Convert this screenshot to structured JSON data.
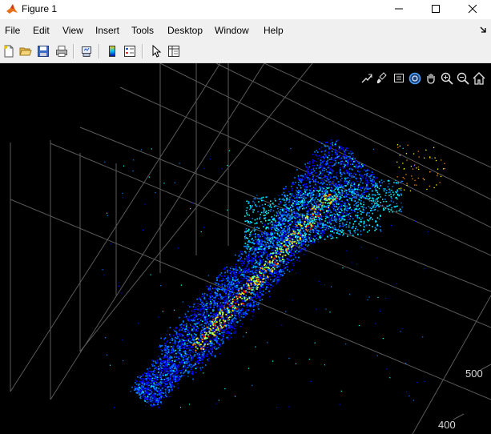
{
  "window": {
    "title": "Figure 1"
  },
  "menu": {
    "items": [
      "File",
      "Edit",
      "View",
      "Insert",
      "Tools",
      "Desktop",
      "Window",
      "Help"
    ]
  },
  "plot": {
    "ticks": [
      "500",
      "400"
    ],
    "colormap": [
      "#00007f",
      "#0000ff",
      "#0080ff",
      "#00ffff",
      "#80ff80",
      "#ffff00",
      "#ff8000",
      "#ff0000"
    ]
  },
  "icons": {
    "toolbar": [
      "new-figure-icon",
      "open-file-icon",
      "save-icon",
      "print-icon",
      "link-plot-icon",
      "colorbar-icon",
      "legend-icon",
      "pointer-icon",
      "property-inspector-icon"
    ],
    "axes": [
      "export-icon",
      "brush-icon",
      "data-tips-icon",
      "rotate-3d-icon",
      "pan-icon",
      "zoom-in-icon",
      "zoom-out-icon",
      "home-icon"
    ]
  }
}
